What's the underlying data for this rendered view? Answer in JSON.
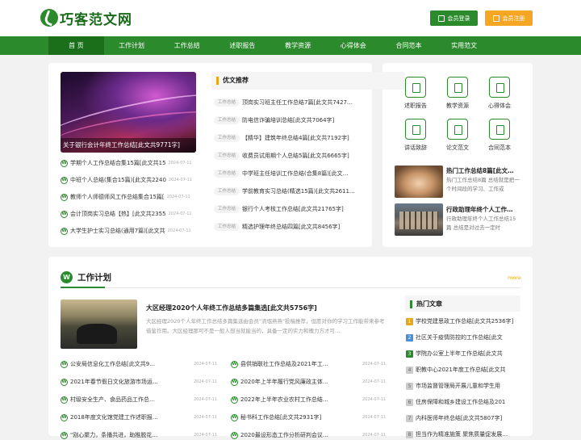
{
  "header": {
    "logo_text": "巧客范文网",
    "login": "会员登录",
    "register": "会员注册"
  },
  "nav": [
    "首 页",
    "工作计划",
    "工作总结",
    "述职报告",
    "教学资源",
    "心得体会",
    "合同范本",
    "实用范文"
  ],
  "banner": {
    "caption": "关于银行会计年终工作总结[此文共9771字]"
  },
  "left_list": [
    {
      "title": "学期个人工作总结合集15篇[此文共15",
      "date": "2024-07-11"
    },
    {
      "title": "中班个人总结(集合15篇)[此文共2240",
      "date": "2024-07-11"
    },
    {
      "title": "教师个人师德师风工作总结集合15篇[",
      "date": "2024-07-11"
    },
    {
      "title": "会计顶岗实习总结【热】[此文共2355",
      "date": "2024-07-11"
    },
    {
      "title": "大学生护士实习总结(通用7篇)[此文共",
      "date": "2024-07-11"
    }
  ],
  "recommend": {
    "title": "优文推荐",
    "tag": "工作总结",
    "items": [
      "顶岗实习班主任工作总结7篇[此文共7427…",
      "防电信诈骗培训总结[此文共7064字]",
      "【精华】建筑年终总结4篇[此文共7192字]",
      "收费员试用期个人总结5篇[此文共6665字]",
      "中学班主任培训工作总结(合集8篇)[此文…",
      "学前教育实习总结(精选15篇)[此文共2611…",
      "银行个人考核工作总结[此文共21765字]",
      "精选护理年终总结四篇[此文共8456字]"
    ]
  },
  "quick_icons": [
    {
      "label": "述职报告",
      "icon": "report-icon"
    },
    {
      "label": "教学资源",
      "icon": "teaching-icon"
    },
    {
      "label": "心得体会",
      "icon": "book-icon"
    },
    {
      "label": "讲话致辞",
      "icon": "speech-icon"
    },
    {
      "label": "论文范文",
      "icon": "paper-icon"
    },
    {
      "label": "合同范本",
      "icon": "contract-icon"
    }
  ],
  "right_articles": [
    {
      "title": "热门工作总结8篇[此文…",
      "desc": "热门工作总结8篇 总结就是把一个时间段的学习、工作或"
    },
    {
      "title": "行政助理年终个人工作…",
      "desc": "行政助理年终个人工作总结15篇 总结是对过去一定时"
    }
  ],
  "plan_section": {
    "title": "工作计划",
    "more": "more",
    "featured": {
      "title": "大区经理2020个人年终工作总结多篇集选[此文共5756字]",
      "desc": "大区经理2020个人年终工作总结多篇集选由会员\"流氓燕燕\"投稿推荐，但愿对你的学习工作能带来参考借鉴作用。大区经理那可不是一般人想当就能当的，具备一定的实力和魄力方才可…"
    },
    "list_left": [
      {
        "title": "公安局信息化工作总结[此文共9…",
        "date": "2024-07-11"
      },
      {
        "title": "2021年春节假日文化旅游市场运…",
        "date": "2024-07-11"
      },
      {
        "title": "村级安全生产、食品药品工作总…",
        "date": "2024-07-11"
      },
      {
        "title": "2018年度文化馆党建工作述职报…",
        "date": "2024-07-11"
      },
      {
        "title": "\"刚心聚力，条播共进，助推脱花…",
        "date": "2024-07-11"
      }
    ],
    "list_right": [
      {
        "title": "县供销联社工作总结及2021年工…",
        "date": "2024-07-11"
      },
      {
        "title": "2020年上半年履行党风廉政主体…",
        "date": "2024-07-11"
      },
      {
        "title": "2022年上半年农业农村工作总结…",
        "date": "2024-07-11"
      },
      {
        "title": "秘书科工作总结[此文共2931字]",
        "date": "2024-07-11"
      },
      {
        "title": "2020最设形态工作分析研判会议…",
        "date": "2024-07-11"
      }
    ]
  },
  "hot": {
    "title": "热门文章",
    "items": [
      {
        "num": "1",
        "title": "学校党建思政工作总结[此文共2536字]"
      },
      {
        "num": "2",
        "title": "社区关于疫情防控的工作总结[此文"
      },
      {
        "num": "3",
        "title": "学院办公室上半年工作总结[此文共"
      },
      {
        "num": "4",
        "title": "职教中心2021年度工作总结[此文共"
      },
      {
        "num": "5",
        "title": "市场监督管理局开展儿童和学生用"
      },
      {
        "num": "6",
        "title": "住房保障和城乡建设工作总结及201"
      },
      {
        "num": "7",
        "title": "内科医师年终总结[此文共5807字]"
      },
      {
        "num": "8",
        "title": "担当作为精准施策 聚焦质量促发展…"
      }
    ]
  }
}
